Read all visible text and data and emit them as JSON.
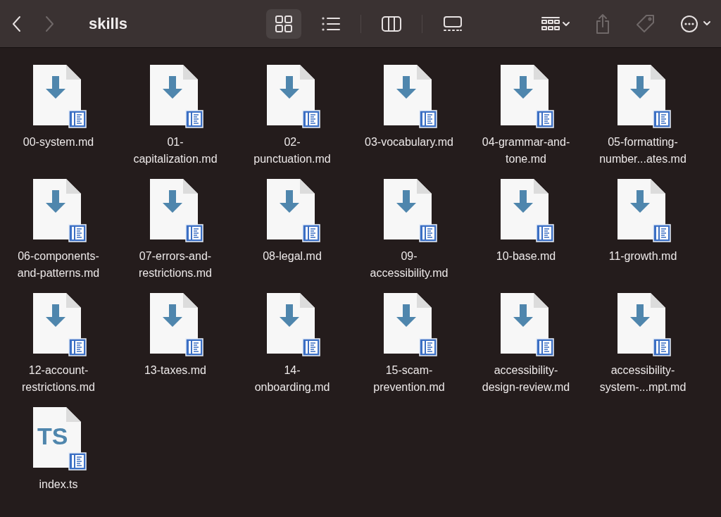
{
  "toolbar": {
    "title": "skills",
    "nav": [
      {
        "kind": "back",
        "disabled": false
      },
      {
        "kind": "forward",
        "disabled": true
      }
    ],
    "view_modes": [
      {
        "kind": "icons",
        "selected": true
      },
      {
        "kind": "list",
        "selected": false
      },
      {
        "kind": "columns",
        "selected": false
      },
      {
        "kind": "gallery",
        "selected": false
      }
    ],
    "actions": [
      {
        "kind": "group",
        "disabled": false
      },
      {
        "kind": "share",
        "disabled": true
      },
      {
        "kind": "tag",
        "disabled": true
      },
      {
        "kind": "more",
        "disabled": false
      }
    ]
  },
  "files": [
    {
      "name": "00-system.md",
      "kind": "markdown"
    },
    {
      "name": "01-capitalization.md",
      "kind": "markdown"
    },
    {
      "name": "02-punctuation.md",
      "kind": "markdown"
    },
    {
      "name": "03-vocabulary.md",
      "kind": "markdown"
    },
    {
      "name": "04-grammar-and-tone.md",
      "kind": "markdown"
    },
    {
      "name": "05-formatting-number...ates.md",
      "kind": "markdown"
    },
    {
      "name": "06-components-and-patterns.md",
      "kind": "markdown"
    },
    {
      "name": "07-errors-and-restrictions.md",
      "kind": "markdown"
    },
    {
      "name": "08-legal.md",
      "kind": "markdown"
    },
    {
      "name": "09-accessibility.md",
      "kind": "markdown"
    },
    {
      "name": "10-base.md",
      "kind": "markdown"
    },
    {
      "name": "11-growth.md",
      "kind": "markdown"
    },
    {
      "name": "12-account-restrictions.md",
      "kind": "markdown"
    },
    {
      "name": "13-taxes.md",
      "kind": "markdown"
    },
    {
      "name": "14-onboarding.md",
      "kind": "markdown"
    },
    {
      "name": "15-scam-prevention.md",
      "kind": "markdown"
    },
    {
      "name": "accessibility-design-review.md",
      "kind": "markdown"
    },
    {
      "name": "accessibility-system-...mpt.md",
      "kind": "markdown"
    },
    {
      "name": "index.ts",
      "kind": "typescript",
      "badge": "TS"
    }
  ]
}
